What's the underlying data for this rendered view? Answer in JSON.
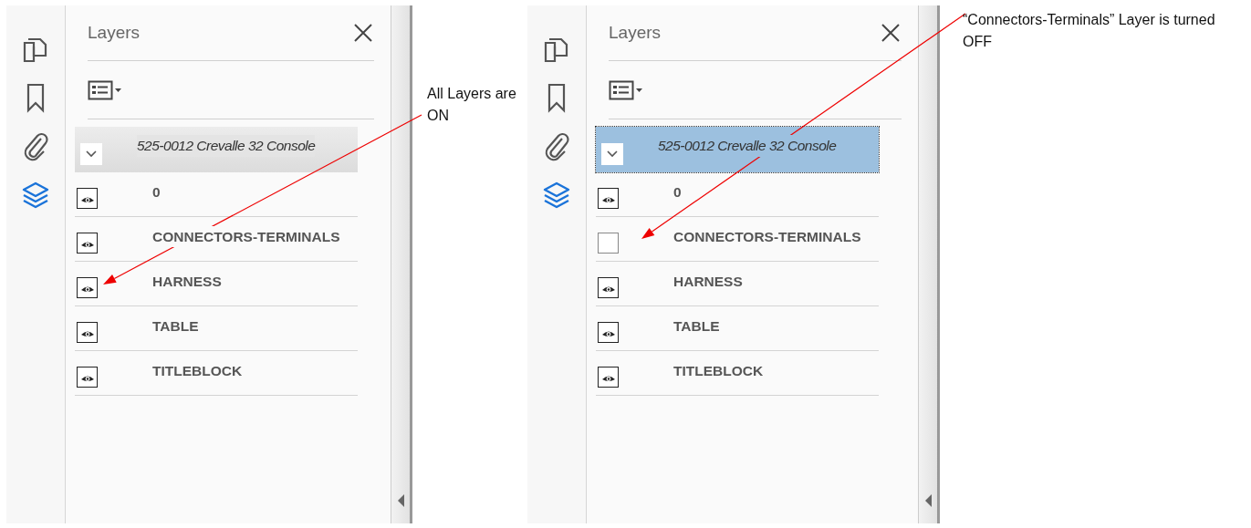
{
  "panels": [
    {
      "title": "Layers",
      "root": {
        "label": "525-0012 Crevalle 32 Console",
        "expanded": true,
        "selected": false
      },
      "layers": [
        {
          "name": "0",
          "visible": true
        },
        {
          "name": "CONNECTORS-TERMINALS",
          "visible": true
        },
        {
          "name": "HARNESS",
          "visible": true
        },
        {
          "name": "TABLE",
          "visible": true
        },
        {
          "name": "TITLEBLOCK",
          "visible": true
        }
      ]
    },
    {
      "title": "Layers",
      "root": {
        "label": "525-0012 Crevalle 32 Console",
        "expanded": true,
        "selected": true
      },
      "layers": [
        {
          "name": "0",
          "visible": true
        },
        {
          "name": "CONNECTORS-TERMINALS",
          "visible": false
        },
        {
          "name": "HARNESS",
          "visible": true
        },
        {
          "name": "TABLE",
          "visible": true
        },
        {
          "name": "TITLEBLOCK",
          "visible": true
        }
      ]
    }
  ],
  "annotations": [
    {
      "text": "All Layers are ON"
    },
    {
      "text": "“Connectors-Terminals” Layer is turned OFF"
    }
  ]
}
